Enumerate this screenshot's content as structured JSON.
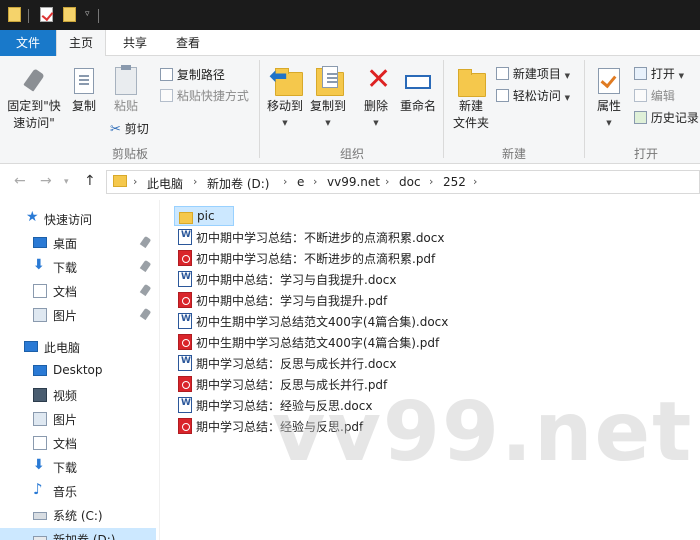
{
  "window": {
    "quick_access_toolbar": [
      "folder-icon",
      "properties-check-icon",
      "new-folder-icon",
      "customize-caret-icon"
    ]
  },
  "ribbon_tabs": {
    "file": "文件",
    "home": "主页",
    "share": "共享",
    "view": "查看"
  },
  "ribbon": {
    "clipboard": {
      "group_label": "剪贴板",
      "pin_label_1": "固定到\"快",
      "pin_label_2": "速访问\"",
      "copy": "复制",
      "paste": "粘贴",
      "copy_path": "复制路径",
      "paste_shortcut": "粘贴快捷方式",
      "cut": "剪切"
    },
    "organize": {
      "group_label": "组织",
      "move_to": "移动到",
      "copy_to": "复制到",
      "delete": "删除",
      "rename": "重命名"
    },
    "new": {
      "group_label": "新建",
      "new_folder_1": "新建",
      "new_folder_2": "文件夹",
      "new_item": "新建项目",
      "easy_access": "轻松访问"
    },
    "open": {
      "group_label": "打开",
      "properties": "属性",
      "open": "打开",
      "edit": "编辑",
      "history": "历史记录"
    }
  },
  "address_bar": {
    "breadcrumbs": [
      "此电脑",
      "新加卷 (D:)",
      "e",
      "vv99.net",
      "doc",
      "252"
    ]
  },
  "sidebar": {
    "items": [
      {
        "label": "快速访问",
        "icon": "star-icon",
        "pinned": false
      },
      {
        "label": "桌面",
        "icon": "desktop-icon",
        "pinned": true
      },
      {
        "label": "下载",
        "icon": "download-icon",
        "pinned": true
      },
      {
        "label": "文档",
        "icon": "documents-icon",
        "pinned": true
      },
      {
        "label": "图片",
        "icon": "pictures-icon",
        "pinned": true
      },
      {
        "label": "此电脑",
        "icon": "this-pc-icon",
        "pinned": false
      },
      {
        "label": "Desktop",
        "icon": "desktop-icon",
        "pinned": false
      },
      {
        "label": "视频",
        "icon": "videos-icon",
        "pinned": false
      },
      {
        "label": "图片",
        "icon": "pictures-icon",
        "pinned": false
      },
      {
        "label": "文档",
        "icon": "documents-icon",
        "pinned": false
      },
      {
        "label": "下载",
        "icon": "download-icon",
        "pinned": false
      },
      {
        "label": "音乐",
        "icon": "music-icon",
        "pinned": false
      },
      {
        "label": "系统 (C:)",
        "icon": "drive-icon",
        "pinned": false
      },
      {
        "label": "新加卷 (D:)",
        "icon": "drive-icon",
        "pinned": false,
        "selected": true
      }
    ]
  },
  "files": [
    {
      "name": "pic",
      "type": "folder",
      "selected": true
    },
    {
      "name": "初中期中学习总结：不断进步的点滴积累.docx",
      "type": "docx"
    },
    {
      "name": "初中期中学习总结：不断进步的点滴积累.pdf",
      "type": "pdf"
    },
    {
      "name": "初中期中总结：学习与自我提升.docx",
      "type": "docx"
    },
    {
      "name": "初中期中总结：学习与自我提升.pdf",
      "type": "pdf"
    },
    {
      "name": "初中生期中学习总结范文400字(4篇合集).docx",
      "type": "docx"
    },
    {
      "name": "初中生期中学习总结范文400字(4篇合集).pdf",
      "type": "pdf"
    },
    {
      "name": "期中学习总结：反思与成长并行.docx",
      "type": "docx"
    },
    {
      "name": "期中学习总结：反思与成长并行.pdf",
      "type": "pdf"
    },
    {
      "name": "期中学习总结：经验与反思.docx",
      "type": "docx"
    },
    {
      "name": "期中学习总结：经验与反思.pdf",
      "type": "pdf"
    }
  ],
  "watermark": "vv99.net",
  "colors": {
    "file_tab": "#1979ca",
    "selection": "#cce8ff",
    "folder": "#f5c84c",
    "pdf": "#d9242a",
    "docx": "#2b579a"
  }
}
